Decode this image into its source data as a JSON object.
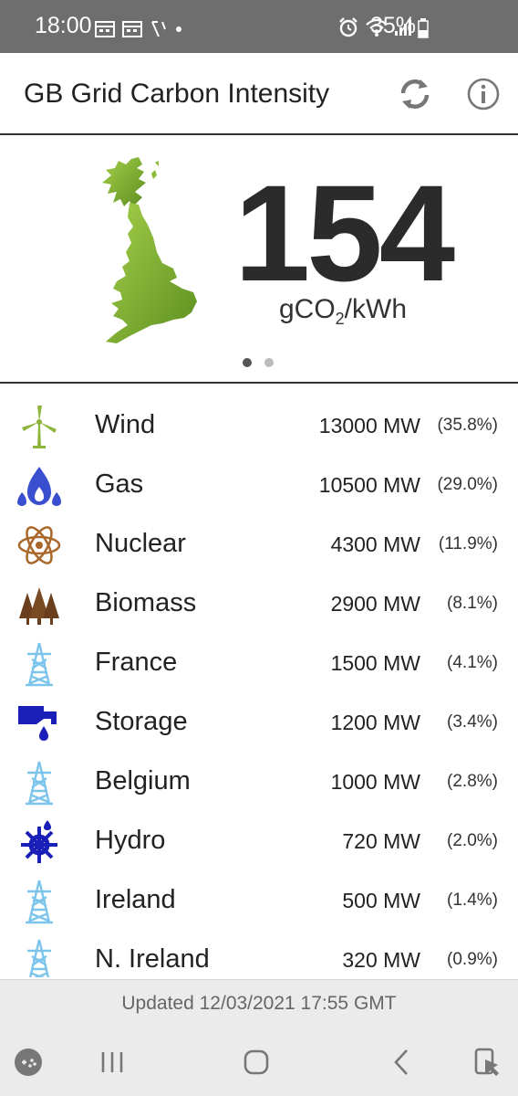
{
  "status_bar": {
    "time": "18:00",
    "battery": "35%"
  },
  "app_bar": {
    "title": "GB Grid Carbon Intensity"
  },
  "hero": {
    "value": "154",
    "unit_prefix": "gCO",
    "unit_sub": "2",
    "unit_suffix": "/kWh"
  },
  "sources": [
    {
      "name": "Wind",
      "mw": "13000 MW",
      "pct": "(35.8%)",
      "icon": "wind-turbine-icon",
      "color": "#8db53c"
    },
    {
      "name": "Gas",
      "mw": "10500 MW",
      "pct": "(29.0%)",
      "icon": "gas-flame-icon",
      "color": "#3a4fcf"
    },
    {
      "name": "Nuclear",
      "mw": "4300 MW",
      "pct": "(11.9%)",
      "icon": "atom-icon",
      "color": "#a9672a"
    },
    {
      "name": "Biomass",
      "mw": "2900 MW",
      "pct": "(8.1%)",
      "icon": "trees-icon",
      "color": "#6b3f1e"
    },
    {
      "name": "France",
      "mw": "1500 MW",
      "pct": "(4.1%)",
      "icon": "pylon-icon",
      "color": "#7cc4ec"
    },
    {
      "name": "Storage",
      "mw": "1200 MW",
      "pct": "(3.4%)",
      "icon": "water-tap-icon",
      "color": "#1a1fb8"
    },
    {
      "name": "Belgium",
      "mw": "1000 MW",
      "pct": "(2.8%)",
      "icon": "pylon-icon",
      "color": "#7cc4ec"
    },
    {
      "name": "Hydro",
      "mw": "720 MW",
      "pct": "(2.0%)",
      "icon": "water-wheel-icon",
      "color": "#1a1fb8"
    },
    {
      "name": "Ireland",
      "mw": "500 MW",
      "pct": "(1.4%)",
      "icon": "pylon-icon",
      "color": "#7cc4ec"
    },
    {
      "name": "N. Ireland",
      "mw": "320 MW",
      "pct": "(0.9%)",
      "icon": "pylon-icon",
      "color": "#7cc4ec"
    }
  ],
  "footer": {
    "updated": "Updated 12/03/2021 17:55 GMT"
  },
  "colors": {
    "status_bar": "#6e6e6e",
    "map_green": "#7fae2e",
    "footer_bg": "#ebebeb"
  }
}
